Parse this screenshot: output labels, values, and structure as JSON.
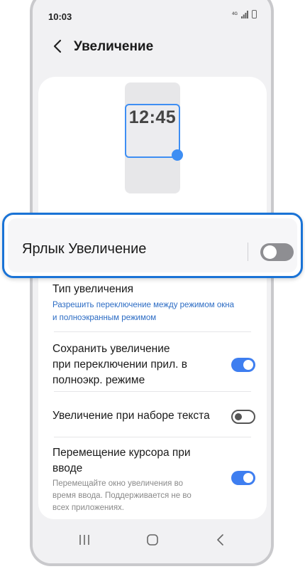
{
  "status_bar": {
    "time": "10:03",
    "network": "4G",
    "icons": [
      "signal-icon",
      "battery-icon"
    ]
  },
  "header": {
    "back_icon": "chevron-left-icon",
    "title": "Увеличение"
  },
  "preview": {
    "clock": "12:45"
  },
  "shortcut": {
    "label": "Ярлык Увеличение",
    "enabled": false
  },
  "settings": {
    "magnification_type": {
      "title": "Тип увеличения",
      "subtitle_line1": "Разрешить переключение между режимом окна",
      "subtitle_line2": "и полноэкранным режимом"
    },
    "keep_on_switch": {
      "title_line1": "Сохранить увеличение",
      "title_line2": "при переключении прил. в",
      "title_line3": "полноэкр. режиме",
      "enabled": true
    },
    "zoom_on_typing": {
      "title": "Увеличение при наборе текста",
      "enabled": false
    },
    "follow_cursor": {
      "title_line1": "Перемещение курсора при",
      "title_line2": "вводе",
      "desc_line1": "Перемещайте окно увеличения во",
      "desc_line2": "время ввода. Поддерживается не во",
      "desc_line3": "всех приложениях.",
      "enabled": true
    }
  },
  "nav_bar": {
    "buttons": [
      "recent-apps-icon",
      "home-icon",
      "back-icon"
    ]
  },
  "colors": {
    "accent": "#3e7ef0",
    "highlight_border": "#1a73d6",
    "link_text": "#2c6cc4"
  }
}
